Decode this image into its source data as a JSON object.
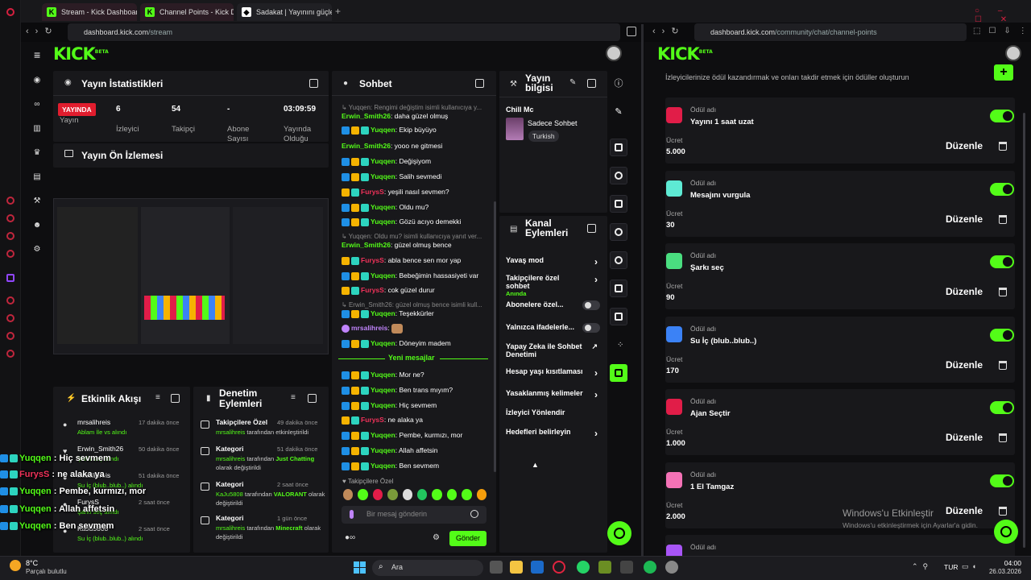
{
  "browser": {
    "tabs": [
      "Stream - Kick Dashboard",
      "Channel Points - Kick Das",
      "Sadakat | Yayınını güçlend"
    ],
    "left_url": {
      "host": "dashboard.kick.com",
      "path": "/stream"
    },
    "right_url": {
      "host": "dashboard.kick.com",
      "path": "/community/chat/channel-points"
    }
  },
  "logo": {
    "text": "KICK",
    "sup": "BETA"
  },
  "stats": {
    "title": "Yayın İstatistikleri",
    "live_badge": "YAYINDA",
    "items": [
      {
        "value": "",
        "label": "Yayın"
      },
      {
        "value": "6",
        "label": "İzleyici"
      },
      {
        "value": "54",
        "label": "Takipçi"
      },
      {
        "value": "-",
        "label": "Abone Sayısı"
      },
      {
        "value": "03:09:59",
        "label": "Yayında Olduğu"
      }
    ]
  },
  "preview": {
    "title": "Yayın Ön İzlemesi"
  },
  "chat": {
    "title": "Sohbet",
    "new_messages": "Yeni mesajlar",
    "emote_label": "Takipçilere Özel",
    "input_placeholder": "Bir mesaj gönderin",
    "send_button": "Gönder",
    "lines": [
      {
        "kind": "reply",
        "text": "Yuqqen: Rengimi değiştim isimli kullanıcıya y..."
      },
      {
        "kind": "msg",
        "badges": 0,
        "user": "Erwin_Smith26",
        "color": "g",
        "text": "daha güzel olmuş"
      },
      {
        "kind": "msg",
        "badges": 3,
        "user": "Yuqqen",
        "color": "g",
        "text": "Ekip büyüyo"
      },
      {
        "kind": "msg",
        "badges": 0,
        "user": "Erwin_Smith26",
        "color": "g",
        "text": "yooo ne gitmesi"
      },
      {
        "kind": "msg",
        "badges": 3,
        "user": "Yuqqen",
        "color": "g",
        "text": "Değişiyom"
      },
      {
        "kind": "msg",
        "badges": 3,
        "user": "Yuqqen",
        "color": "g",
        "text": "Salih sevmedi"
      },
      {
        "kind": "msg",
        "badges": 2,
        "user": "FurysS",
        "color": "r",
        "text": "yeşili nasıl sevmen?"
      },
      {
        "kind": "msg",
        "badges": 3,
        "user": "Yuqqen",
        "color": "g",
        "text": "Oldu mu?"
      },
      {
        "kind": "msg",
        "badges": 3,
        "user": "Yuqqen",
        "color": "g",
        "text": "Gözü acıyo demekki"
      },
      {
        "kind": "reply",
        "text": "Yuqqen: Oldu mu? isimli kullanıcıya yanıt ver..."
      },
      {
        "kind": "msg",
        "badges": 0,
        "user": "Erwin_Smith26",
        "color": "g",
        "text": "güzel olmuş bence"
      },
      {
        "kind": "msg",
        "badges": 2,
        "user": "FurysS",
        "color": "r",
        "text": "abla bence sen mor yap"
      },
      {
        "kind": "msg",
        "badges": 3,
        "user": "Yuqqen",
        "color": "g",
        "text": "Bebeğimin hassasiyeti var"
      },
      {
        "kind": "msg",
        "badges": 2,
        "user": "FurysS",
        "color": "r",
        "text": "cok güzel durur"
      },
      {
        "kind": "reply",
        "text": "Erwin_Smith26: güzel olmuş bence isimli kull..."
      },
      {
        "kind": "msg",
        "badges": 3,
        "user": "Yuqqen",
        "color": "g",
        "text": "Teşekkürler"
      },
      {
        "kind": "msg",
        "badges": 1,
        "user": "mrsalihreis",
        "color": "p",
        "text": ""
      },
      {
        "kind": "msg",
        "badges": 3,
        "user": "Yuqqen",
        "color": "g",
        "text": "Döneyim madem"
      },
      {
        "kind": "sep",
        "text": ""
      },
      {
        "kind": "msg",
        "badges": 3,
        "user": "Yuqqen",
        "color": "g",
        "text": "Mor ne?"
      },
      {
        "kind": "msg",
        "badges": 3,
        "user": "Yuqqen",
        "color": "g",
        "text": "Ben trans mıyım?"
      },
      {
        "kind": "msg",
        "badges": 3,
        "user": "Yuqqen",
        "color": "g",
        "text": "Hiç sevmem"
      },
      {
        "kind": "msg",
        "badges": 2,
        "user": "FurysS",
        "color": "r",
        "text": "ne alaka ya"
      },
      {
        "kind": "msg",
        "badges": 3,
        "user": "Yuqqen",
        "color": "g",
        "text": "Pembe, kurmızı, mor"
      },
      {
        "kind": "msg",
        "badges": 3,
        "user": "Yuqqen",
        "color": "g",
        "text": "Allah affetsin"
      },
      {
        "kind": "msg",
        "badges": 3,
        "user": "Yuqqen",
        "color": "g",
        "text": "Ben sevmem"
      }
    ]
  },
  "stream_info": {
    "title": "Yayın bilgisi",
    "stream_title": "Chill Mc",
    "category": "Sadece Sohbet",
    "tag": "Turkish"
  },
  "channel_actions": {
    "title": "Kanal Eylemleri",
    "items": [
      {
        "label": "Yavaş mod",
        "sub": "",
        "ctrl": "chev"
      },
      {
        "label": "Takipçilere özel sohbet",
        "sub": "Anında",
        "ctrl": "chev"
      },
      {
        "label": "Abonelere özel...",
        "sub": "",
        "ctrl": "toggle"
      },
      {
        "label": "Yalnızca ifadelerle...",
        "sub": "",
        "ctrl": "toggle"
      },
      {
        "label": "Yapay Zeka ile Sohbet Denetimi",
        "sub": "",
        "ctrl": "ext"
      },
      {
        "label": "Hesap yaşı kısıtlaması",
        "sub": "",
        "ctrl": "chev"
      },
      {
        "label": "Yasaklanmış kelimeler",
        "sub": "",
        "ctrl": "chev"
      },
      {
        "label": "İzleyici Yönlendir",
        "sub": "",
        "ctrl": "none"
      },
      {
        "label": "Hedefleri belirleyin",
        "sub": "",
        "ctrl": "chev"
      }
    ]
  },
  "activity": {
    "title": "Etkinlik Akışı",
    "items": [
      {
        "name": "mrsalihreis",
        "time": "17 dakika önce",
        "detail": "Ablam İle vs alındı"
      },
      {
        "name": "Erwin_Smith26",
        "time": "50 dakika önce",
        "detail": "Şarkı seç alındı"
      },
      {
        "name": "mrsalihreis",
        "time": "51 dakika önce",
        "detail": "Su İç (blub..blub..) alındı"
      },
      {
        "name": "FurysS",
        "time": "2 saat önce",
        "detail": "Şarkı seç alındı"
      },
      {
        "name": "KaJu5808",
        "time": "2 saat önce",
        "detail": "Su İç (blub..blub..) alındı"
      }
    ]
  },
  "moderation": {
    "title": "Denetim Eylemleri",
    "items": [
      {
        "title": "Takipçilere Özel",
        "time": "49 dakika önce",
        "who": "mrsalihreis",
        "detail": "tarafından etkinleştirildi",
        "target": ""
      },
      {
        "title": "Kategori",
        "time": "51 dakika önce",
        "who": "mrsalihreis",
        "detail": "tarafından",
        "target": "Just Chatting",
        "tail": "olarak değiştirildi"
      },
      {
        "title": "Kategori",
        "time": "2 saat önce",
        "who": "KaJu5808",
        "detail": "tarafından",
        "target": "VALORANT",
        "tail": "olarak değiştirildi"
      },
      {
        "title": "Kategori",
        "time": "1 gün önce",
        "who": "mrsalihreis",
        "detail": "tarafından",
        "target": "Minecraft",
        "tail": "olarak değiştirildi"
      }
    ]
  },
  "rewards": {
    "subtitle": "İzleyicilerinize ödül kazandırmak ve onları takdir etmek için ödüller oluşturun",
    "name_label": "Ödül adı",
    "cost_label": "Ücret",
    "edit_label": "Düzenle",
    "items": [
      {
        "name": "Yayını 1 saat uzat",
        "cost": "5.000",
        "color": "#e11d48"
      },
      {
        "name": "Mesajını vurgula",
        "cost": "30",
        "color": "#5eead4"
      },
      {
        "name": "Şarkı seç",
        "cost": "90",
        "color": "#4ade80"
      },
      {
        "name": "Su İç (blub..blub..)",
        "cost": "170",
        "color": "#3b82f6"
      },
      {
        "name": "Ajan Seçtir",
        "cost": "1.000",
        "color": "#e11d48"
      },
      {
        "name": "1 El Tamgaz",
        "cost": "2.000",
        "color": "#f472b6"
      },
      {
        "name": "Ödül adı",
        "cost": "",
        "color": "#a855f7"
      }
    ]
  },
  "overlay_chat": [
    {
      "user": "Yuqqen",
      "text": "Hiç sevmem"
    },
    {
      "user": "FurysS",
      "text": "ne alaka ya"
    },
    {
      "user": "Yuqqen",
      "text": "Pembe, kurmızı, mor"
    },
    {
      "user": "Yuqqen",
      "text": "Allah affetsin"
    },
    {
      "user": "Yuqqen",
      "text": "Ben sevmem"
    }
  ],
  "windows_watermark": {
    "line1": "Windows'u Etkinleştir",
    "line2": "Windows'u etkinleştirmek için Ayarlar'a gidin."
  },
  "taskbar": {
    "weather_temp": "8°C",
    "weather_desc": "Parçalı bulutlu",
    "search": "Ara",
    "lang": "TUR",
    "time": "04:00",
    "date": "26.03.2026"
  },
  "colors": {
    "accent": "#53fc18",
    "live": "#e11d2e",
    "panel": "#18181b"
  }
}
